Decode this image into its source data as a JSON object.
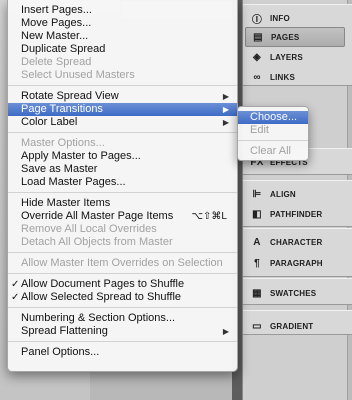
{
  "menu": {
    "groups": [
      [
        {
          "label": "Insert Pages...",
          "enabled": true
        },
        {
          "label": "Move Pages...",
          "enabled": true
        },
        {
          "label": "New Master...",
          "enabled": true
        },
        {
          "label": "Duplicate Spread",
          "enabled": true
        },
        {
          "label": "Delete Spread",
          "enabled": false
        },
        {
          "label": "Select Unused Masters",
          "enabled": false
        }
      ],
      [
        {
          "label": "Rotate Spread View",
          "enabled": true,
          "submenu": true
        },
        {
          "label": "Page Transitions",
          "enabled": true,
          "submenu": true,
          "highlighted": true
        },
        {
          "label": "Color Label",
          "enabled": true,
          "submenu": true
        }
      ],
      [
        {
          "label": "Master Options...",
          "enabled": false
        },
        {
          "label": "Apply Master to Pages...",
          "enabled": true
        },
        {
          "label": "Save as Master",
          "enabled": true
        },
        {
          "label": "Load Master Pages...",
          "enabled": true
        }
      ],
      [
        {
          "label": "Hide Master Items",
          "enabled": true
        },
        {
          "label": "Override All Master Page Items",
          "enabled": true,
          "shortcut": "⌥⇧⌘L"
        },
        {
          "label": "Remove All Local Overrides",
          "enabled": false
        },
        {
          "label": "Detach All Objects from Master",
          "enabled": false
        }
      ],
      [
        {
          "label": "Allow Master Item Overrides on Selection",
          "enabled": false
        }
      ],
      [
        {
          "label": "Allow Document Pages to Shuffle",
          "enabled": true,
          "checked": true
        },
        {
          "label": "Allow Selected Spread to Shuffle",
          "enabled": true,
          "checked": true
        }
      ],
      [
        {
          "label": "Numbering & Section Options...",
          "enabled": true
        },
        {
          "label": "Spread Flattening",
          "enabled": true,
          "submenu": true
        }
      ],
      [
        {
          "label": "Panel Options...",
          "enabled": true
        }
      ]
    ],
    "check_glyph": "✓",
    "arrow_glyph": "▶"
  },
  "submenu": {
    "items": [
      {
        "label": "Choose...",
        "enabled": true,
        "highlighted": true
      },
      {
        "label": "Edit",
        "enabled": false
      },
      {
        "label": "Clear All",
        "enabled": false
      }
    ]
  },
  "dock": {
    "items": [
      {
        "label": "INFO",
        "icon": "info-icon",
        "glyph": "ⓘ"
      },
      {
        "label": "PAGES",
        "icon": "pages-icon",
        "glyph": "▤",
        "active": true
      },
      {
        "label": "LAYERS",
        "icon": "layers-icon",
        "glyph": "◈"
      },
      {
        "label": "LINKS",
        "icon": "links-icon",
        "glyph": "∞"
      },
      {
        "label": "EFFECTS",
        "icon": "effects-icon",
        "glyph": "fx"
      },
      {
        "label": "ALIGN",
        "icon": "align-icon",
        "glyph": "⊫"
      },
      {
        "label": "PATHFINDER",
        "icon": "pathfinder-icon",
        "glyph": "◧"
      },
      {
        "label": "CHARACTER",
        "icon": "character-icon",
        "glyph": "A"
      },
      {
        "label": "PARAGRAPH",
        "icon": "paragraph-icon",
        "glyph": "¶"
      },
      {
        "label": "SWATCHES",
        "icon": "swatches-icon",
        "glyph": "▦"
      },
      {
        "label": "GRADIENT",
        "icon": "gradient-icon",
        "glyph": "▭"
      }
    ]
  },
  "colors": {
    "highlight": "#3e6bc7",
    "disabled_text": "#a2a2a2"
  }
}
